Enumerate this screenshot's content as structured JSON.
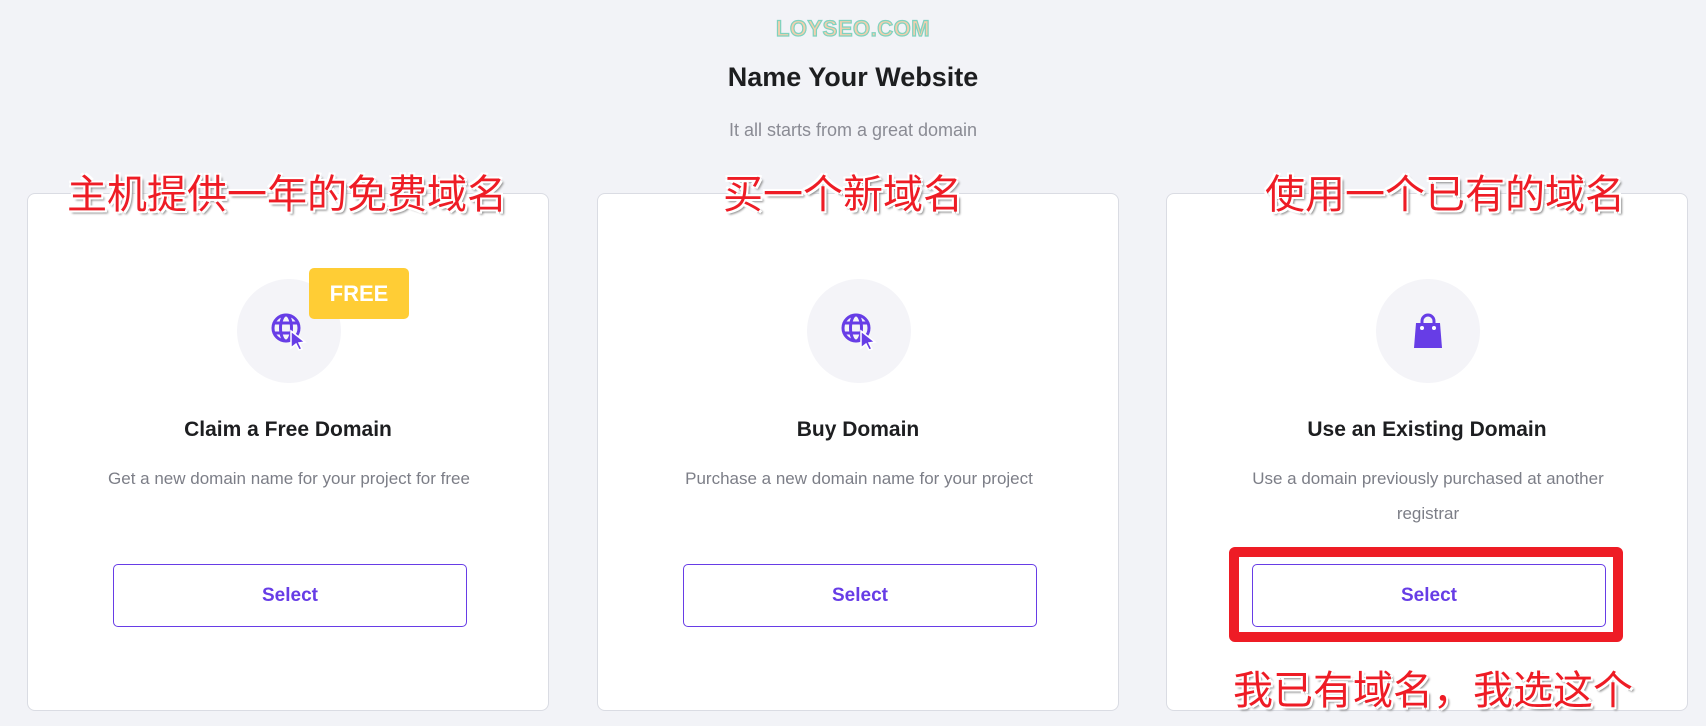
{
  "watermark": "LOYSEO.COM",
  "header": {
    "title": "Name Your Website",
    "subtitle": "It all starts from a great domain"
  },
  "accent_color": "#673de6",
  "badge_color": "#ffcd35",
  "annotation_color": "#ee1c25",
  "cards": [
    {
      "icon": "globe-cursor-icon",
      "badge": "FREE",
      "title": "Claim a Free Domain",
      "desc": "Get a new domain name for your project for free",
      "button": "Select",
      "annotation": "主机提供一年的免费域名"
    },
    {
      "icon": "globe-cursor-icon",
      "title": "Buy Domain",
      "desc": "Purchase a new domain name for your project",
      "button": "Select",
      "annotation": "买一个新域名"
    },
    {
      "icon": "shopping-bag-icon",
      "title": "Use an Existing Domain",
      "desc": "Use a domain previously purchased at another registrar",
      "button": "Select",
      "annotation": "使用一个已有的域名"
    }
  ],
  "bottom_annotation": "我已有域名，我选这个"
}
